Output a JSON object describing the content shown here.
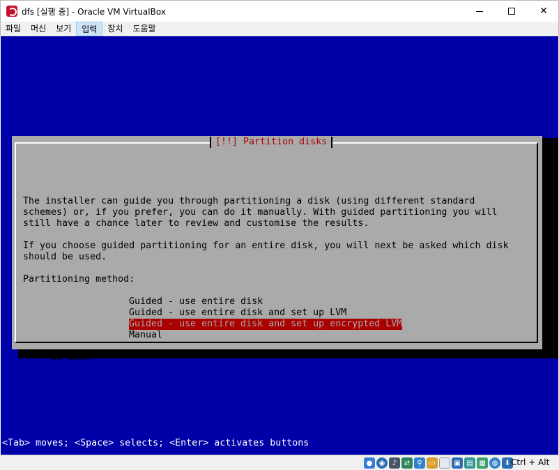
{
  "window": {
    "title": "dfs [실행 중] - Oracle VM VirtualBox",
    "minimize_glyph": "",
    "close_glyph": "✕"
  },
  "menu": {
    "items": [
      "파일",
      "머신",
      "보기",
      "입력",
      "장치",
      "도움말"
    ],
    "active_index": 3
  },
  "installer": {
    "dialog_title": "[!!] Partition disks",
    "paragraph1": [
      "The installer can guide you through partitioning a disk (using different standard",
      "schemes) or, if you prefer, you can do it manually. With guided partitioning you will",
      "still have a chance later to review and customise the results."
    ],
    "paragraph2": [
      "If you choose guided partitioning for an entire disk, you will next be asked which disk",
      "should be used."
    ],
    "method_label": "Partitioning method:",
    "options": [
      "Guided - use entire disk",
      "Guided - use entire disk and set up LVM",
      "Guided - use entire disk and set up encrypted LVM",
      "Manual"
    ],
    "selected_option_index": 2,
    "go_back": "<Go Back>",
    "hint": "<Tab> moves; <Space> selects; <Enter> activates buttons"
  },
  "colors": {
    "screen_bg": "#0000a8",
    "dialog_bg": "#aaaaaa",
    "title_red": "#aa0000",
    "selection_bg": "#aa0000"
  },
  "statusbar": {
    "icons": [
      "hard-disk-icon",
      "optical-drive-icon",
      "audio-icon",
      "network-icon",
      "usb-icon",
      "shared-folder-icon",
      "display-icon",
      "video-capture-icon",
      "cpu-icon",
      "mouse-integration-icon",
      "keyboard-icon"
    ],
    "host_key": "Ctrl + Alt"
  }
}
